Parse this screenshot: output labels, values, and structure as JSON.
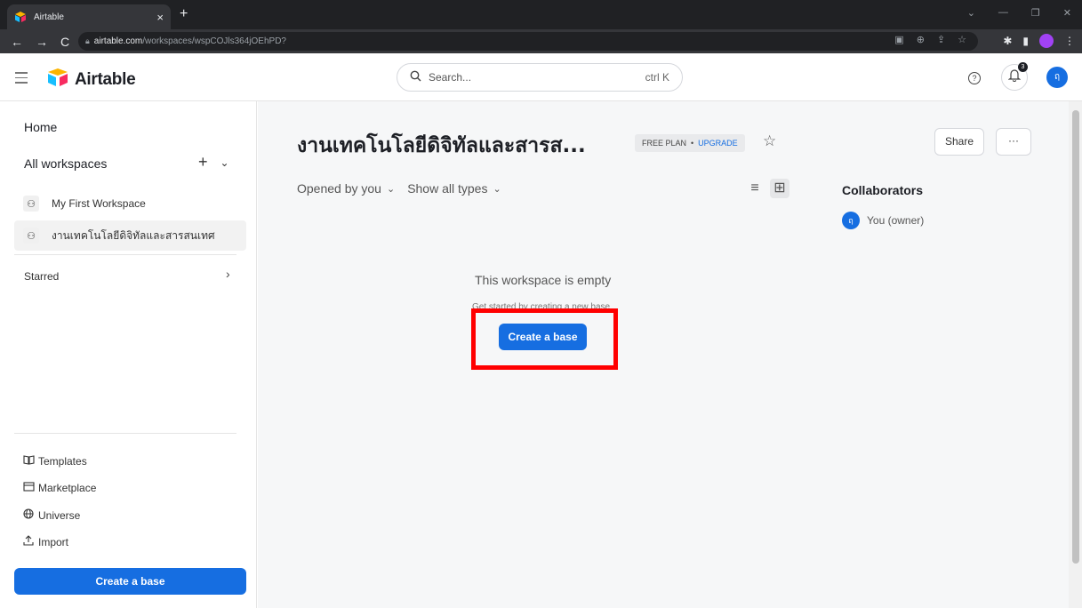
{
  "browser": {
    "tab_title": "Airtable",
    "tab_close": "×",
    "new_tab": "+",
    "url_host": "airtable.com",
    "url_path": "/workspaces/wspCOJls364jOEhPD?"
  },
  "header": {
    "app_name": "Airtable",
    "search_placeholder": "Search...",
    "search_shortcut": "ctrl K",
    "help": "?",
    "notification_count": "3",
    "avatar_initial": "ฤ"
  },
  "sidebar": {
    "home": "Home",
    "all_workspaces": "All workspaces",
    "workspaces": [
      {
        "label": "My First Workspace"
      },
      {
        "label": "งานเทคโนโลยีดิจิทัลและสารสนเทศ"
      }
    ],
    "starred": "Starred",
    "links": [
      {
        "label": "Templates",
        "icon": "book-icon"
      },
      {
        "label": "Marketplace",
        "icon": "marketplace-icon"
      },
      {
        "label": "Universe",
        "icon": "globe-icon"
      },
      {
        "label": "Import",
        "icon": "upload-icon"
      }
    ],
    "create_base": "Create a base"
  },
  "main": {
    "title": "งานเทคโนโลยีดิจิทัลและสารส...",
    "plan": "FREE PLAN",
    "plan_sep": "•",
    "upgrade": "UPGRADE",
    "share": "Share",
    "more": "···",
    "filter_opened": "Opened by you",
    "filter_types": "Show all types",
    "collaborators_title": "Collaborators",
    "collaborator_name": "You (owner)",
    "collaborator_initial": "ฤ",
    "empty_title": "This workspace is empty",
    "empty_subtitle": "Get started by creating a new base",
    "create_base": "Create a base"
  },
  "colors": {
    "accent": "#166ee1",
    "highlight": "#ff0000"
  }
}
